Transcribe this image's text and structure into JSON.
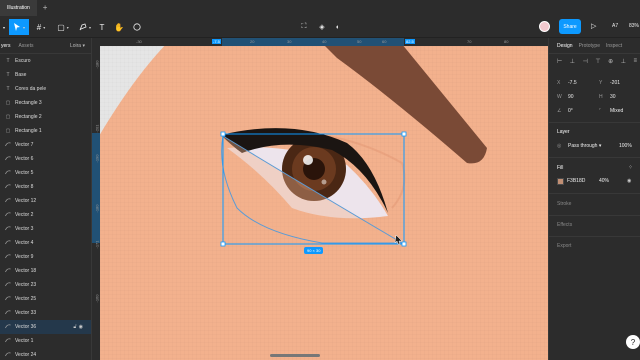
{
  "tabbar": {
    "file_tab": "Illustration",
    "plus": "+"
  },
  "toolbar": {
    "tools": [
      "move-tool",
      "frame-tool",
      "shape-tool",
      "pen-tool",
      "text-tool",
      "hand-tool",
      "comment-tool"
    ],
    "center_tools": [
      "edit-object-icon",
      "component-icon",
      "mask-icon"
    ],
    "share_label": "Share",
    "play": "▷",
    "notifications": "A7",
    "zoom": "83%"
  },
  "left_panel": {
    "tab_layers": "yers",
    "tab_assets": "Assets",
    "page": "Loira",
    "layers": [
      {
        "icon": "text-icon",
        "glyph": "T",
        "label": "Escuro"
      },
      {
        "icon": "text-icon",
        "glyph": "T",
        "label": "Base"
      },
      {
        "icon": "text-icon",
        "glyph": "T",
        "label": "Cores da pele"
      },
      {
        "icon": "rect-icon",
        "glyph": "▢",
        "label": "Rectangle 3"
      },
      {
        "icon": "rect-icon",
        "glyph": "▢",
        "label": "Rectangle 2"
      },
      {
        "icon": "rect-icon",
        "glyph": "▢",
        "label": "Rectangle 1"
      },
      {
        "icon": "vector-icon",
        "glyph": "",
        "label": "Vector 7"
      },
      {
        "icon": "vector-icon",
        "glyph": "",
        "label": "Vector 6"
      },
      {
        "icon": "vector-icon",
        "glyph": "",
        "label": "Vector 5"
      },
      {
        "icon": "vector-icon",
        "glyph": "",
        "label": "Vector 8"
      },
      {
        "icon": "vector-icon",
        "glyph": "",
        "label": "Vector 12"
      },
      {
        "icon": "vector-icon",
        "glyph": "",
        "label": "Vector 2"
      },
      {
        "icon": "vector-icon",
        "glyph": "",
        "label": "Vector 3"
      },
      {
        "icon": "vector-icon",
        "glyph": "",
        "label": "Vector 4"
      },
      {
        "icon": "vector-icon",
        "glyph": "",
        "label": "Vector 9"
      },
      {
        "icon": "vector-icon",
        "glyph": "",
        "label": "Vector 18"
      },
      {
        "icon": "vector-icon",
        "glyph": "",
        "label": "Vector 23"
      },
      {
        "icon": "vector-icon",
        "glyph": "",
        "label": "Vector 25"
      },
      {
        "icon": "vector-icon",
        "glyph": "",
        "label": "Vector 33"
      },
      {
        "icon": "vector-icon",
        "glyph": "",
        "label": "Vector 36",
        "selected": true
      },
      {
        "icon": "vector-icon",
        "glyph": "",
        "label": "Vector 1"
      },
      {
        "icon": "vector-icon",
        "glyph": "",
        "label": "Vector 24"
      }
    ]
  },
  "rulers": {
    "top": [
      "-30",
      "-7.5",
      "20",
      "30",
      "40",
      "50",
      "60",
      "82.5",
      "70",
      "80"
    ],
    "left": [
      "-180",
      "-201",
      "-190",
      "-180",
      "-171",
      "-160"
    ]
  },
  "canvas": {
    "selection_size": "90 × 30",
    "colors": {
      "skin": "#f3b18d",
      "brow": "#7a4a36",
      "selection": "#0d99ff"
    }
  },
  "right_panel": {
    "tabs": [
      "Design",
      "Prototype",
      "Inspect"
    ],
    "x_label": "X",
    "x_value": "-7.5",
    "y_label": "Y",
    "y_value": "-201",
    "w_label": "W",
    "w_value": "90",
    "h_label": "H",
    "h_value": "30",
    "rotation": "0°",
    "corner": "Mixed",
    "layer_title": "Layer",
    "blend_mode": "Pass through",
    "opacity": "100%",
    "fill_title": "Fill",
    "fill_hex": "F3B18D",
    "fill_opacity": "40%",
    "stroke_title": "Stroke",
    "effects_title": "Effects",
    "export_title": "Export"
  },
  "help": "?"
}
